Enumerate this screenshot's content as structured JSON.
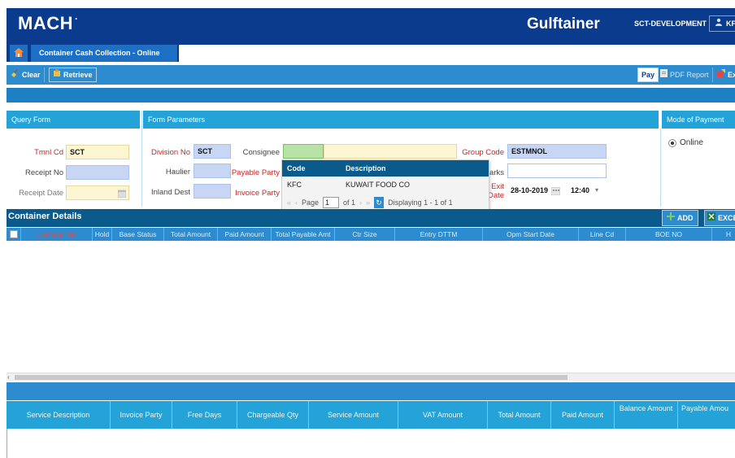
{
  "header": {
    "app_logo": "MACH",
    "logo_dot": "·",
    "brand": "Gulftainer",
    "environment": "SCT-DEVELOPMENT",
    "user": "KFC"
  },
  "tabs": {
    "active": "Container Cash Collection - Online"
  },
  "toolbar": {
    "clear": "Clear",
    "retrieve": "Retrieve",
    "pay": "Pay",
    "pdf_report": "PDF Report",
    "export": "Ex"
  },
  "query_form": {
    "title": "Query Form",
    "tmnl_cd_label": "Tmnl Cd",
    "tmnl_cd_value": "SCT",
    "receipt_no_label": "Receipt No",
    "receipt_date_label": "Receipt Date"
  },
  "form_params": {
    "title": "Form Parameters",
    "division_no_label": "Division No",
    "division_no_value": "SCT",
    "haulier_label": "Haulier",
    "inland_dest_label": "Inland Dest",
    "consignee_label": "Consignee",
    "payable_party_label": "Payable Party",
    "invoice_party_label": "Invoice Party",
    "group_code_label": "Group Code",
    "group_code_value": "ESTMNOL",
    "remarks_label": "arks",
    "exit_label_1": "Exit",
    "exit_label_2": "Date",
    "exit_date": "28-10-2019",
    "exit_time": "12:40"
  },
  "dropdown": {
    "col_code": "Code",
    "col_desc": "Description",
    "rows": [
      {
        "code": "KFC",
        "description": "KUWAIT FOOD CO"
      }
    ],
    "page_label": "Page",
    "page_value": "1",
    "of_label": "of 1",
    "displaying": "Displaying 1 - 1 of 1"
  },
  "mode_of_payment": {
    "title": "Mode of Payment",
    "option": "Online"
  },
  "container_details": {
    "title": "Container Details",
    "add": "ADD",
    "excel": "EXCEL",
    "columns": [
      "Container No",
      "Hold",
      "Base Status",
      "Total Amount",
      "Paid Amount",
      "Total Payable Amt",
      "Ctr Size",
      "Entry DTTM",
      "Opm Start Date",
      "Line Cd",
      "BOE NO",
      "H"
    ]
  },
  "service_grid": {
    "columns": [
      "Service Description",
      "Invoice Party",
      "Free Days",
      "Chargeable Qty",
      "Service Amount",
      "VAT Amount",
      "Total Amount",
      "Paid Amount",
      "Balance Amount",
      "Payable Amou"
    ]
  }
}
